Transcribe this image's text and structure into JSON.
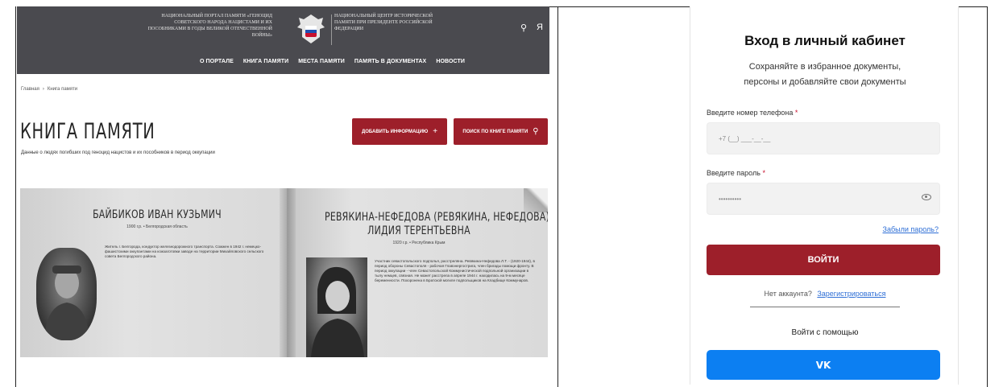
{
  "portal": {
    "left_caption": "Национальный портал памяти «Геноцид советского народа нацистами и их пособниками в годы Великой Отечественной войны»",
    "right_caption": "Национальный центр исторической памяти при Президенте Российской Федерации",
    "nav": [
      "О ПОРТАЛЕ",
      "КНИГА ПАМЯТИ",
      "МЕСТА ПАМЯТИ",
      "ПАМЯТЬ В ДОКУМЕНТАХ",
      "НОВОСТИ"
    ],
    "breadcrumb": [
      "Главная",
      "Книга памяти"
    ],
    "title": "КНИГА ПАМЯТИ",
    "subtitle": "Данные о людях погибших под геноцид нацистов и их пособников в период оккупации",
    "add_info_button": "ДОБАВИТЬ ИНФОРМАЦИЮ",
    "search_button": "ПОИСК ПО КНИГЕ ПАМЯТИ",
    "persons": [
      {
        "name": "БАЙБИКОВ ИВАН КУЗЬМИЧ",
        "meta": "1900 г.р. • Белгородская область",
        "bio": "Житель г. Белгорода, кондуктор железнодорожного транспорта. Сожжен в 1942 г. немецко-фашистскими оккупантами на кожзаготовки заводе на территории Михайловского сельского совета Белгородского района."
      },
      {
        "name_line1": "РЕВЯКИНА-НЕФЕДОВА (РЕВЯКИНА, НЕФЕДОВА)",
        "name_line2": "ЛИДИЯ ТЕРЕНТЬЕВНА",
        "meta": "1920 г.р. • Республика Крым",
        "bio": "Участник севастопольского подполья, расстреляна. Ревякина-Нефедова Л.Т. - (1920-1944), в период обороны Севастополя - рабочая Главэнергострига, член бригады помощи фронту. В период оккупации - член Севастопольской Коммунистической подпольной организации в тылу немцев, связная. Не может расстрела в апреле 1944 г. находилась на 9-м месяце беременности. Похоронена в Братской могиле подпольщиков на Кладбище Коммунаров."
      }
    ]
  },
  "login": {
    "title": "Вход в личный кабинет",
    "subtitle_line1": "Сохраняйте в избранное документы,",
    "subtitle_line2": "персоны и добавляйте свои документы",
    "phone_label": "Введите номер телефона",
    "phone_placeholder": "+7 (__) ___-__-__",
    "password_label": "Введите пароль",
    "password_value": "••••••••••",
    "required_mark": "*",
    "forgot_link": "Забыли пароль?",
    "login_button": "ВОЙТИ",
    "no_account": "Нет аккаунта?",
    "register_link": "Зарегистрироваться",
    "login_with": "Войти с помощью",
    "vk_button": "VK"
  },
  "colors": {
    "brand_red": "#9d1f2a",
    "vk_blue": "#0c7ff2",
    "topbar": "#4a4a4f"
  }
}
